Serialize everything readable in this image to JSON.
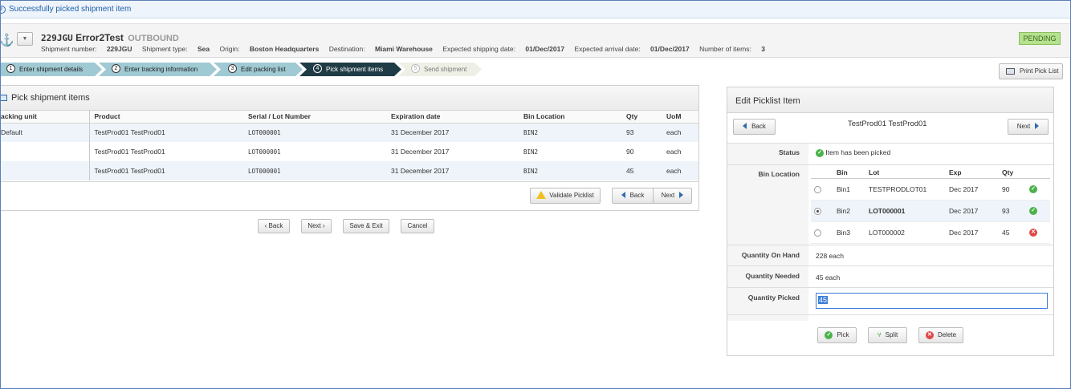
{
  "notification": {
    "message": "Successfully picked shipment item"
  },
  "header": {
    "shipment_code": "229JGU",
    "shipment_name": "Error2Test",
    "direction": "OUTBOUND",
    "status": "PENDING",
    "meta": {
      "shipment_number_label": "Shipment number:",
      "shipment_number": "229JGU",
      "shipment_type_label": "Shipment type:",
      "shipment_type": "Sea",
      "origin_label": "Origin:",
      "origin": "Boston Headquarters",
      "destination_label": "Destination:",
      "destination": "Miami Warehouse",
      "exp_ship_label": "Expected shipping date:",
      "exp_ship": "01/Dec/2017",
      "exp_arrival_label": "Expected arrival date:",
      "exp_arrival": "01/Dec/2017",
      "num_items_label": "Number of items:",
      "num_items": "3"
    }
  },
  "wizard": {
    "steps": [
      {
        "num": "1",
        "label": "Enter shipment details"
      },
      {
        "num": "2",
        "label": "Enter tracking information"
      },
      {
        "num": "3",
        "label": "Edit packing list"
      },
      {
        "num": "4",
        "label": "Pick shipment items"
      },
      {
        "num": "5",
        "label": "Send shipment"
      }
    ],
    "active_step": 4
  },
  "print_button": {
    "label": "Print Pick List"
  },
  "pick_panel": {
    "title": "Pick shipment items",
    "columns": [
      "acking unit",
      "Product",
      "Serial / Lot Number",
      "Expiration date",
      "Bin Location",
      "Qty",
      "UoM"
    ],
    "rows": [
      {
        "unit": "Default",
        "product": "TestProd01 TestProd01",
        "lot": "LOT000001",
        "expiration": "31 December 2017",
        "bin": "BIN2",
        "qty": "93",
        "uom": "each"
      },
      {
        "unit": "",
        "product": "TestProd01 TestProd01",
        "lot": "LOT000001",
        "expiration": "31 December 2017",
        "bin": "BIN2",
        "qty": "90",
        "uom": "each"
      },
      {
        "unit": "",
        "product": "TestProd01 TestProd01",
        "lot": "LOT000001",
        "expiration": "31 December 2017",
        "bin": "BIN2",
        "qty": "45",
        "uom": "each"
      }
    ],
    "validate_label": "Validate Picklist",
    "back_label": "Back",
    "next_label": "Next"
  },
  "wizard_nav": {
    "back_label": "‹ Back",
    "next_label": "Next ›",
    "save_exit_label": "Save & Exit",
    "cancel_label": "Cancel"
  },
  "edit_panel": {
    "title": "Edit Picklist Item",
    "back_label": "Back",
    "next_label": "Next",
    "product": "TestProd01 TestProd01",
    "status_label": "Status",
    "status_text": "Item has been picked",
    "bin_location_label": "Bin Location",
    "bin_columns": [
      "Bin",
      "Lot",
      "Exp",
      "Qty"
    ],
    "bins": [
      {
        "bin": "Bin1",
        "lot": "TESTPRODLOT01",
        "exp": "Dec 2017",
        "qty": "90",
        "state": "ok",
        "selected": false
      },
      {
        "bin": "Bin2",
        "lot": "LOT000001",
        "exp": "Dec 2017",
        "qty": "93",
        "state": "ok",
        "selected": true
      },
      {
        "bin": "Bin3",
        "lot": "LOT000002",
        "exp": "Dec 2017",
        "qty": "45",
        "state": "error",
        "selected": false
      }
    ],
    "qty_on_hand_label": "Quantity On Hand",
    "qty_on_hand": "228 each",
    "qty_needed_label": "Quantity Needed",
    "qty_needed": "45 each",
    "qty_picked_label": "Quantity Picked",
    "qty_picked": "45",
    "pick_label": "Pick",
    "split_label": "Split",
    "delete_label": "Delete"
  },
  "colors": {
    "active_step": "#1f3b45",
    "done_step": "#9fc9d3",
    "status_badge": "#b6e18f",
    "ok": "#4bb24b",
    "error": "#e04848",
    "link_blue": "#2e6bb0"
  }
}
